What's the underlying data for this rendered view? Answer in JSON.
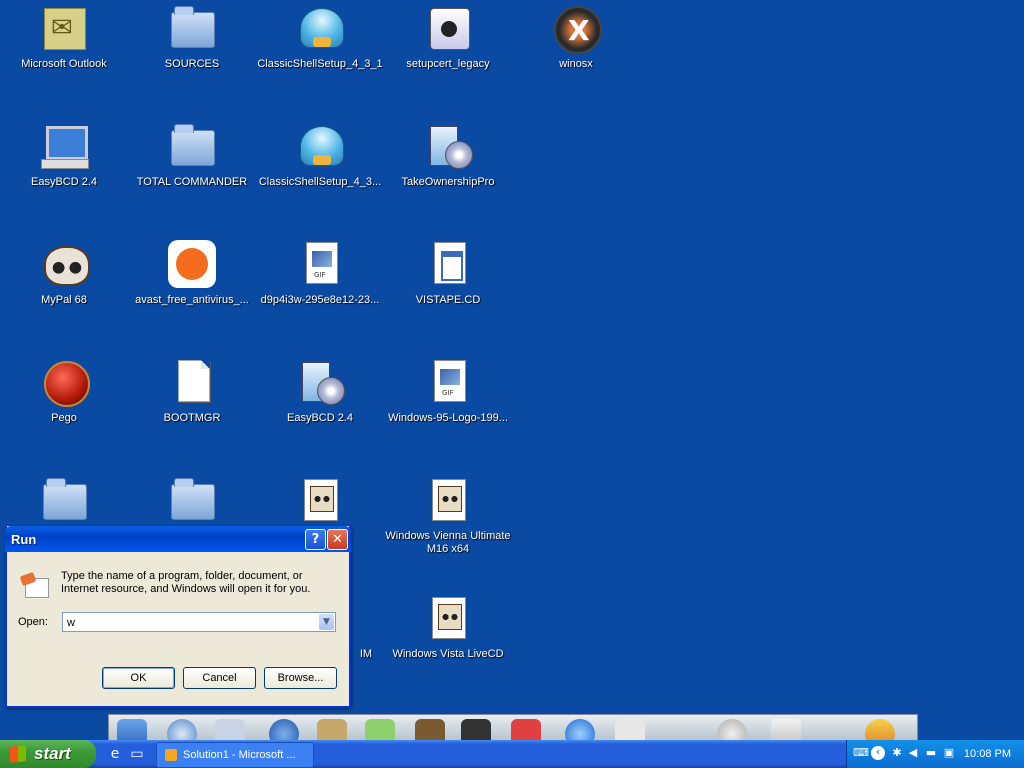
{
  "desktop": {
    "icons": [
      {
        "label": "Microsoft Outlook"
      },
      {
        "label": "SOURCES"
      },
      {
        "label": "ClassicShellSetup_4_3_1"
      },
      {
        "label": "setupcert_legacy"
      },
      {
        "label": "winosx"
      },
      {
        "label": "EasyBCD 2.4"
      },
      {
        "label": "TOTAL COMMANDER"
      },
      {
        "label": "ClassicShellSetup_4_3..."
      },
      {
        "label": "TakeOwnershipPro"
      },
      {
        "label": "MyPal 68"
      },
      {
        "label": "avast_free_antivirus_..."
      },
      {
        "label": "d9p4i3w-295e8e12-23..."
      },
      {
        "label": "VISTAPE.CD"
      },
      {
        "label": "Pego"
      },
      {
        "label": "BOOTMGR"
      },
      {
        "label": "EasyBCD 2.4"
      },
      {
        "label": "Windows-95-Logo-199..."
      },
      {
        "label": "Windows Vienna Ultimate\nM16 x64"
      },
      {
        "label": "IM"
      },
      {
        "label": "Windows Vista LiveCD"
      }
    ]
  },
  "run_dialog": {
    "title": "Run",
    "help_button": "?",
    "close_button": "✕",
    "description": "Type the name of a program, folder, document, or Internet resource, and Windows will open it for you.",
    "open_label": "Open:",
    "open_value": "w",
    "ok": "OK",
    "cancel": "Cancel",
    "browse": "Browse..."
  },
  "taskbar": {
    "start_label": "start",
    "task_label": "Solution1 - Microsoft ...",
    "clock": "10:08 PM"
  }
}
